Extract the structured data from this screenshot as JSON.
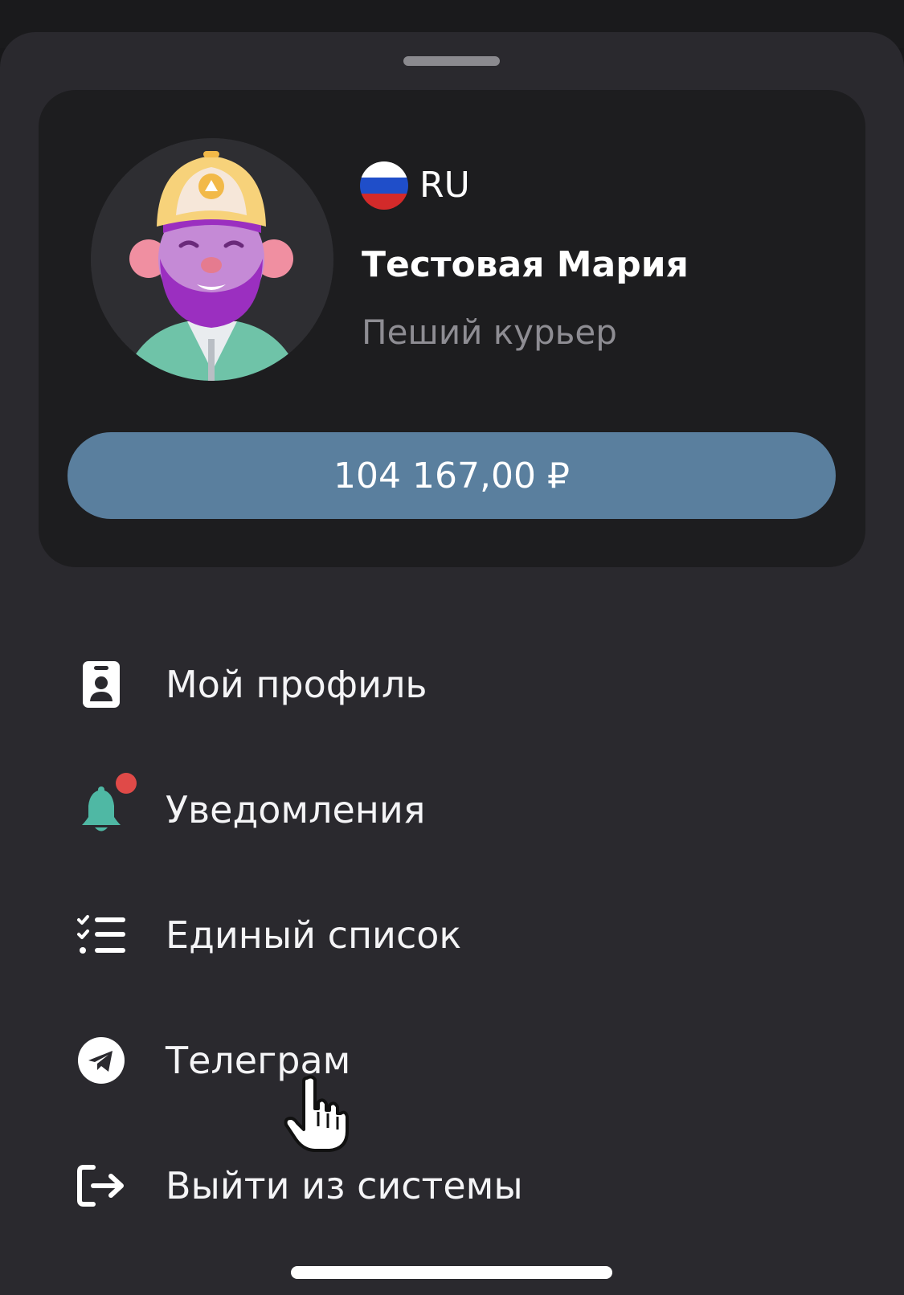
{
  "profile": {
    "language_code": "RU",
    "flag_icon": "russia-flag-icon",
    "flag_colors": [
      "#ffffff",
      "#1f4ec9",
      "#d32a2a"
    ],
    "name": "Тестовая Мария",
    "role": "Пеший курьер",
    "avatar_icon": "bearded-courier-avatar"
  },
  "balance": {
    "amount": "104 167,00 ₽",
    "color": "#5a7f9e"
  },
  "menu": {
    "items": [
      {
        "label": "Мой профиль",
        "icon": "profile-badge-icon"
      },
      {
        "label": "Уведомления",
        "icon": "bell-icon",
        "has_unread_dot": true
      },
      {
        "label": "Единый список",
        "icon": "checklist-icon"
      },
      {
        "label": "Телеграм",
        "icon": "telegram-icon"
      },
      {
        "label": "Выйти из системы",
        "icon": "logout-icon"
      }
    ]
  },
  "colors": {
    "sheet_background": "#2a292e",
    "card_background": "#1d1d1f",
    "bell_accent": "#4fb8a4",
    "notification_dot": "#e04a48"
  }
}
